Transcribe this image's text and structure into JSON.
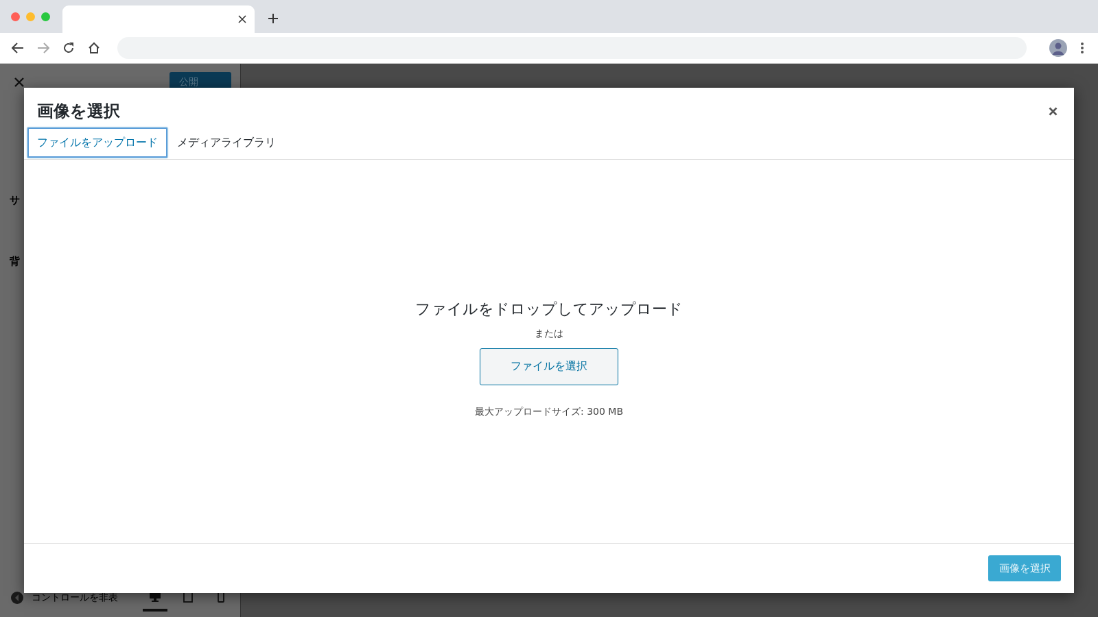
{
  "background": {
    "publish_button": "公開",
    "section_labels": [
      "サ",
      "背"
    ],
    "hide_controls": "コントロールを非表",
    "devices": [
      {
        "kind": "desktop",
        "selected": true
      },
      {
        "kind": "tablet",
        "selected": false
      },
      {
        "kind": "mobile",
        "selected": false
      }
    ]
  },
  "modal": {
    "title": "画像を選択",
    "tabs": [
      {
        "label": "ファイルをアップロード",
        "selected": true
      },
      {
        "label": "メディアライブラリ",
        "selected": false
      }
    ],
    "drop_text": "ファイルをドロップしてアップロード",
    "or_text": "または",
    "select_button": "ファイルを選択",
    "max_size": "最大アップロードサイズ: 300 MB",
    "footer_button": {
      "label": "画像を選択",
      "disabled": true
    }
  }
}
